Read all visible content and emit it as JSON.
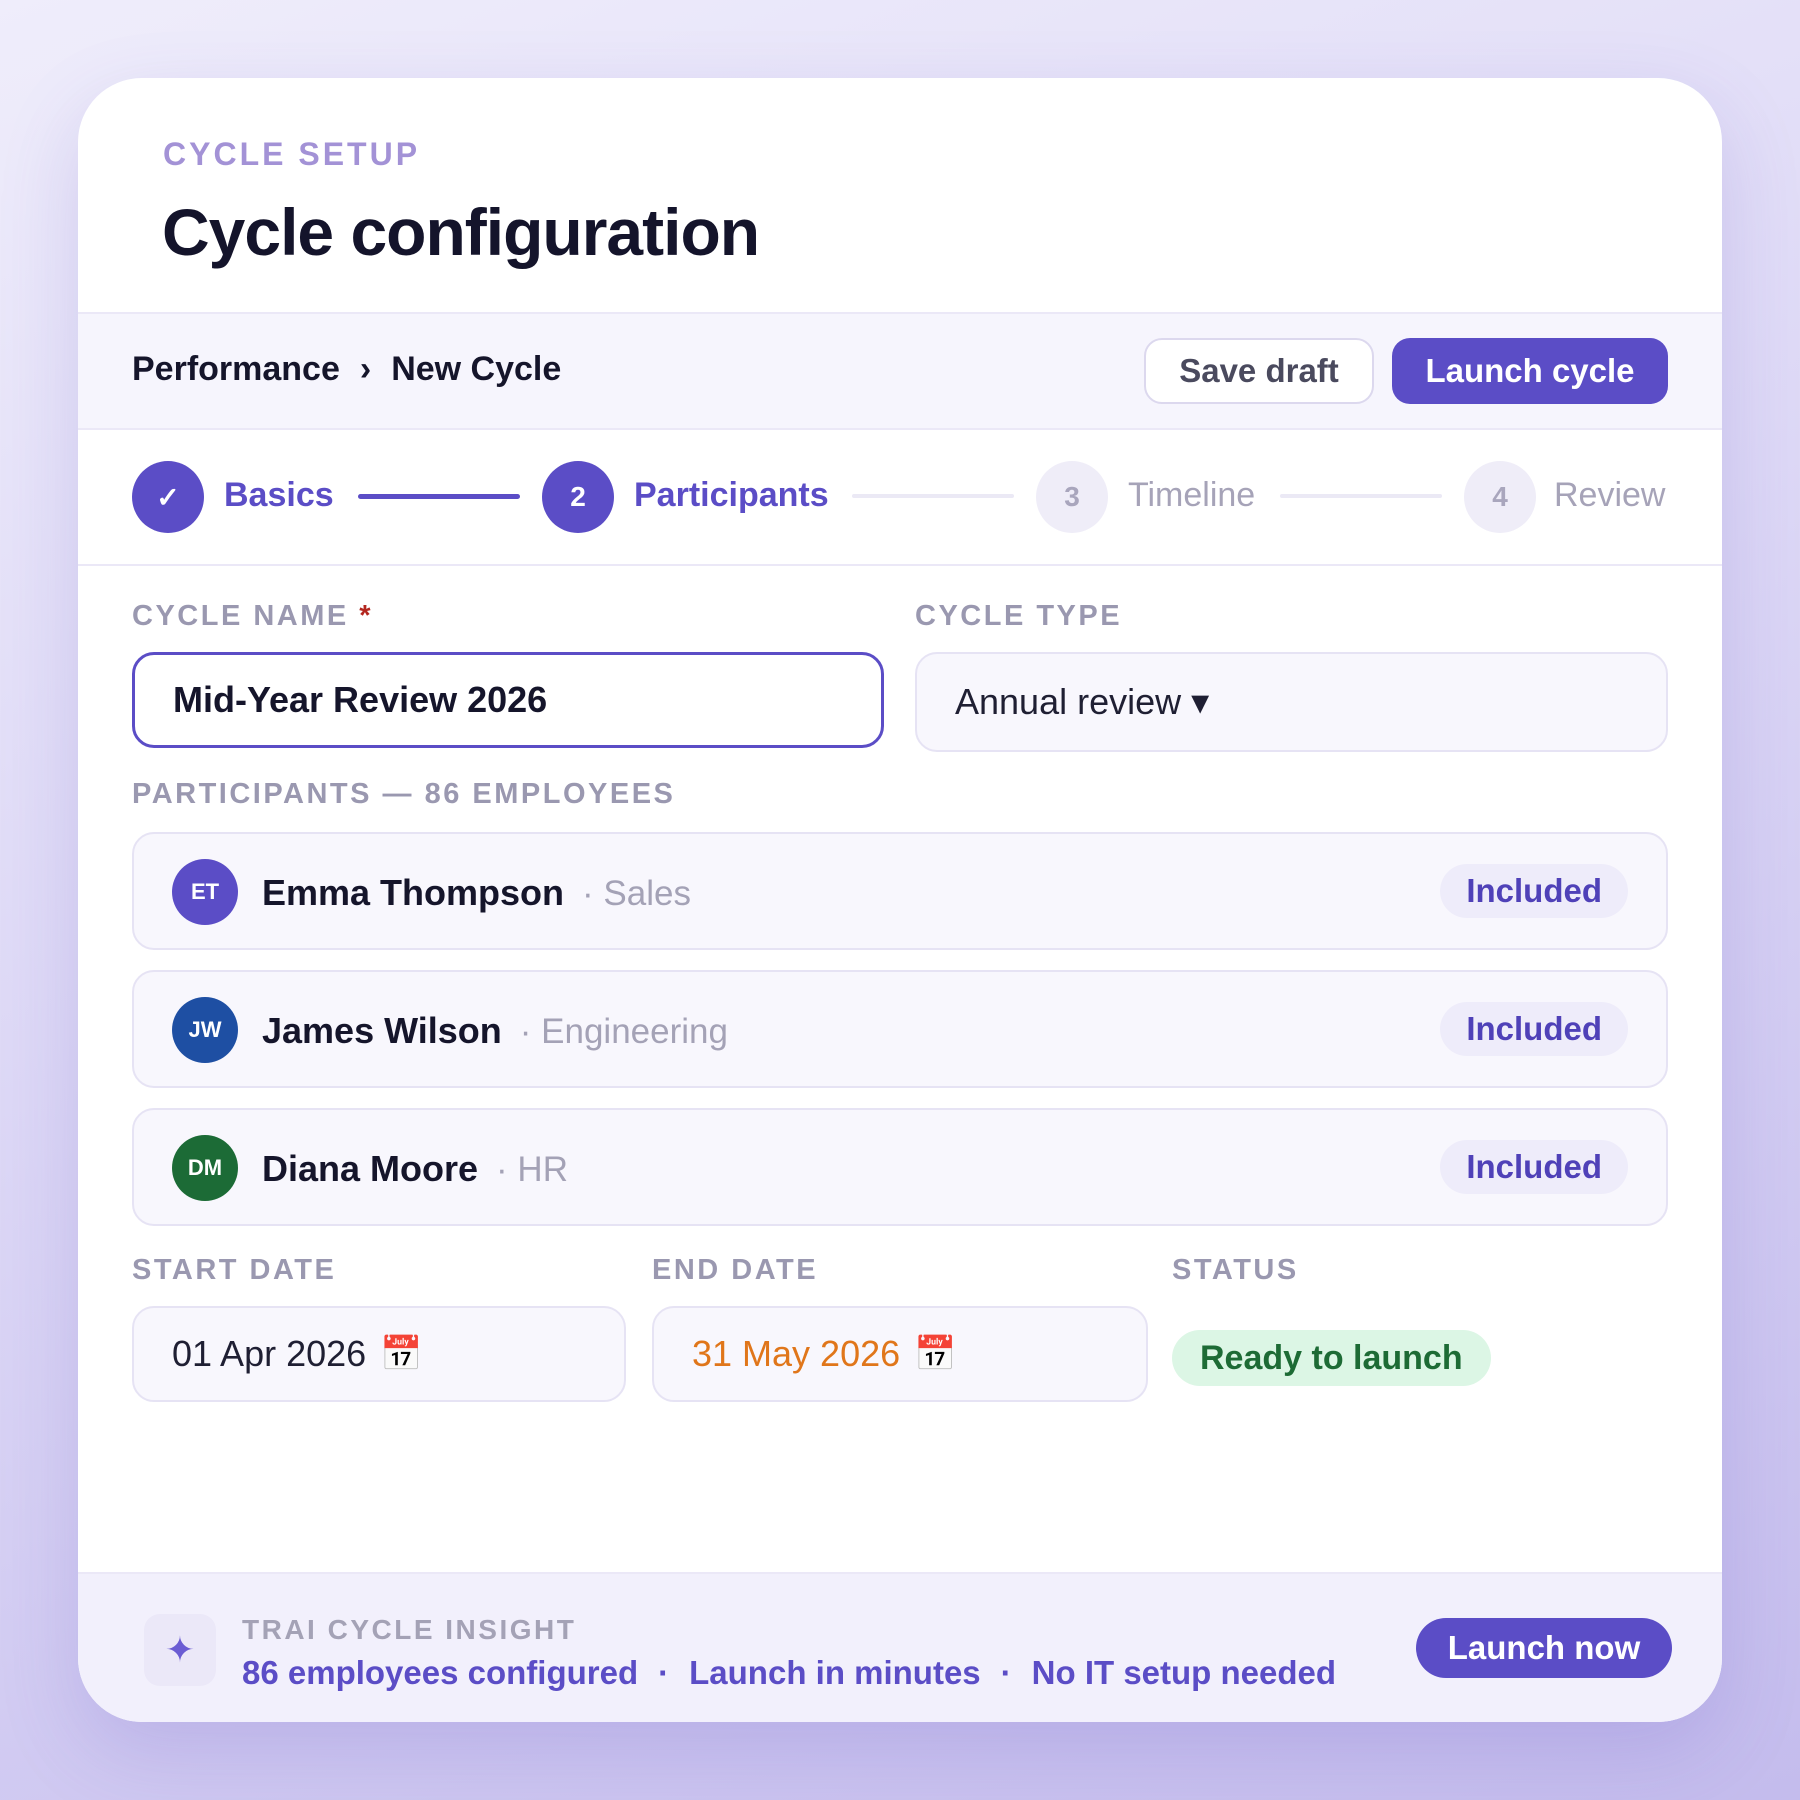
{
  "header": {
    "eyebrow": "CYCLE SETUP",
    "title": "Cycle configuration"
  },
  "breadcrumb": {
    "items": [
      "Performance",
      "New Cycle"
    ],
    "separator": "›"
  },
  "toolbar": {
    "save_label": "Save draft",
    "launch_label": "Launch cycle"
  },
  "stepper": {
    "steps": [
      {
        "marker": "✓",
        "label": "Basics",
        "state": "done"
      },
      {
        "marker": "2",
        "label": "Participants",
        "state": "active"
      },
      {
        "marker": "3",
        "label": "Timeline",
        "state": "todo"
      },
      {
        "marker": "4",
        "label": "Review",
        "state": "todo"
      }
    ]
  },
  "form": {
    "cycle_name_label": "CYCLE NAME",
    "required_mark": "*",
    "cycle_name_value": "Mid-Year Review 2026",
    "cycle_type_label": "CYCLE TYPE",
    "cycle_type_value": "Annual review ▾",
    "participants_label": "PARTICIPANTS — 86 EMPLOYEES",
    "start_date_label": "START DATE",
    "start_date_value": "01 Apr 2026",
    "end_date_label": "END DATE",
    "end_date_value": "31 May 2026",
    "status_label": "STATUS",
    "status_value": "Ready to launch",
    "calendar_glyph": "📅"
  },
  "participants": [
    {
      "initials": "ET",
      "name": "Emma Thompson",
      "dept": "· Sales",
      "badge": "Included",
      "color": "#5b4dc6"
    },
    {
      "initials": "JW",
      "name": "James Wilson",
      "dept": "· Engineering",
      "badge": "Included",
      "color": "#1e4fa3"
    },
    {
      "initials": "DM",
      "name": "Diana Moore",
      "dept": "· HR",
      "badge": "Included",
      "color": "#1c6b36"
    }
  ],
  "footer": {
    "icon": "sparkle-icon",
    "title": "TRAI CYCLE INSIGHT",
    "facts": [
      "86 employees configured",
      "Launch in minutes",
      "No IT setup needed"
    ],
    "separator": "·",
    "cta_label": "Launch now"
  },
  "colors": {
    "accent": "#5b4dc6",
    "end_date": "#e0761a",
    "status_bg": "#dcf6e5",
    "status_text": "#1d6b35"
  }
}
